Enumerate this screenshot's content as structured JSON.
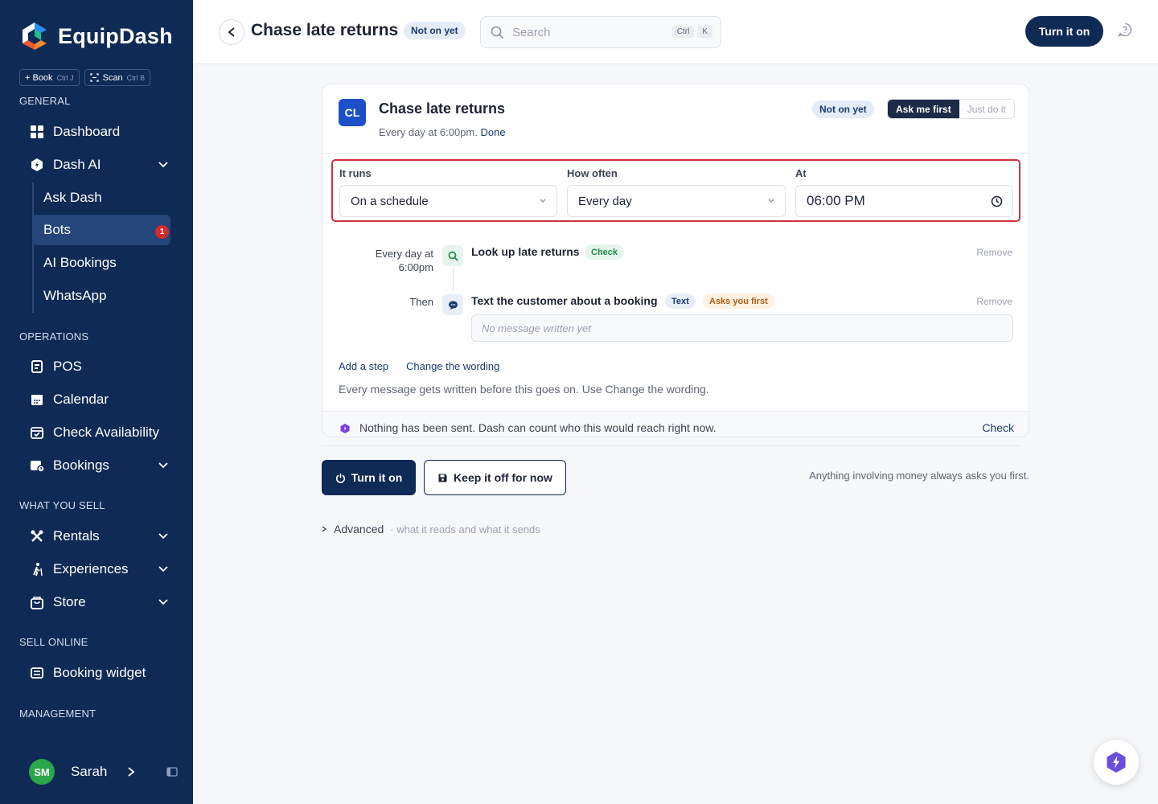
{
  "app": {
    "name": "EquipDash"
  },
  "quick": {
    "book_label": "+ Book",
    "book_kbd": "Ctrl J",
    "scan_label": "Scan",
    "scan_kbd": "Ctrl B"
  },
  "sidebar": {
    "sections": {
      "general": "GENERAL",
      "operations": "OPERATIONS",
      "what_you_sell": "WHAT YOU SELL",
      "sell_online": "SELL ONLINE",
      "management": "MANAGEMENT"
    },
    "items": {
      "dashboard": "Dashboard",
      "dash_ai": "Dash AI",
      "ask_dash": "Ask Dash",
      "bots": "Bots",
      "bots_badge": "1",
      "ai_bookings": "AI Bookings",
      "whatsapp": "WhatsApp",
      "pos": "POS",
      "calendar": "Calendar",
      "check_availability": "Check Availability",
      "bookings": "Bookings",
      "rentals": "Rentals",
      "experiences": "Experiences",
      "store": "Store",
      "booking_widget": "Booking widget"
    },
    "user": {
      "initials": "SM",
      "name": "Sarah"
    }
  },
  "header": {
    "title": "Chase late returns",
    "status": "Not on yet",
    "search_placeholder": "Search",
    "kbd_ctrl": "Ctrl",
    "kbd_k": "K",
    "turn_on": "Turn it on"
  },
  "card": {
    "initials": "CL",
    "title": "Chase late returns",
    "subtitle": "Every day at 6:00pm.",
    "subtitle_done": "Done",
    "status": "Not on yet",
    "mode_on": "Ask me first",
    "mode_off": "Just do it",
    "schedule": {
      "runs_label": "It runs",
      "runs_value": "On a schedule",
      "often_label": "How often",
      "often_value": "Every day",
      "at_label": "At",
      "at_value": "06:00 PM"
    },
    "steps": [
      {
        "label": "Every day at 6:00pm",
        "title": "Look up late returns",
        "tag": "Check",
        "remove": "Remove"
      },
      {
        "label": "Then",
        "title": "Text the customer about a booking",
        "tag": "Text",
        "tag2": "Asks you first",
        "remove": "Remove",
        "message_placeholder": "No message written yet"
      }
    ],
    "add_step": "Add a step",
    "change_wording": "Change the wording",
    "hint": "Every message gets written before this goes on. Use Change the wording.",
    "footer_text": "Nothing has been sent. Dash can count who this would reach right now.",
    "footer_check": "Check"
  },
  "actions": {
    "turn_on": "Turn it on",
    "keep_off": "Keep it off for now",
    "money_note": "Anything involving money always asks you first.",
    "advanced": "Advanced",
    "advanced_sub": "· what it reads and what it sends"
  },
  "colors": {
    "sidebar": "#0e2a55",
    "primary": "#0e2a55",
    "highlight_border": "#d0323d",
    "badge_red": "#d42a2a",
    "avatar_green": "#29a74a",
    "check_tag": "#1f8a4c",
    "asks_tag": "#b35b12"
  }
}
